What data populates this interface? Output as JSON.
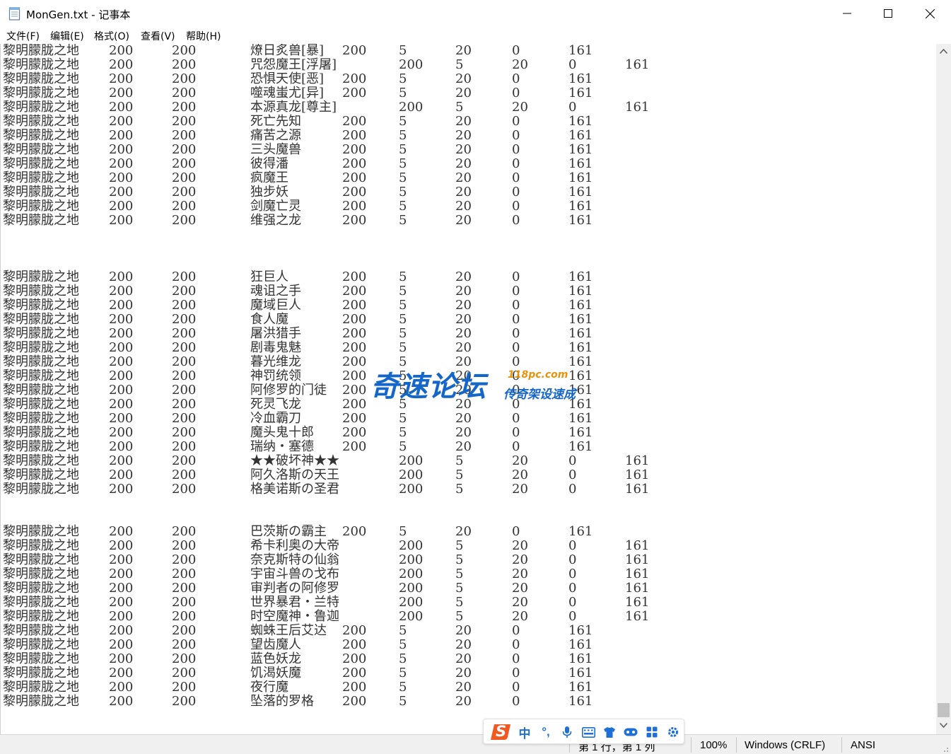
{
  "window": {
    "title": "MonGen.txt - 记事本",
    "icon": "notepad-icon"
  },
  "menu": {
    "items": [
      "文件(F)",
      "编辑(E)",
      "格式(O)",
      "查看(V)",
      "帮助(H)"
    ]
  },
  "editor": {
    "rows": [
      [
        "黎明朦胧之地",
        "200",
        "200",
        "燎日炙兽[暴]",
        "200",
        "5",
        "20",
        "0",
        "161"
      ],
      [
        "黎明朦胧之地",
        "200",
        "200",
        "咒怨魔王[浮屠]",
        "",
        "200",
        "5",
        "20",
        "0",
        "161"
      ],
      [
        "黎明朦胧之地",
        "200",
        "200",
        "恐惧天使[恶]",
        "200",
        "5",
        "20",
        "0",
        "161"
      ],
      [
        "黎明朦胧之地",
        "200",
        "200",
        "噬魂蚩尤[异]",
        "200",
        "5",
        "20",
        "0",
        "161"
      ],
      [
        "黎明朦胧之地",
        "200",
        "200",
        "本源真龙[尊主]",
        "",
        "200",
        "5",
        "20",
        "0",
        "161"
      ],
      [
        "黎明朦胧之地",
        "200",
        "200",
        "死亡先知",
        "200",
        "5",
        "20",
        "0",
        "161"
      ],
      [
        "黎明朦胧之地",
        "200",
        "200",
        "痛苦之源",
        "200",
        "5",
        "20",
        "0",
        "161"
      ],
      [
        "黎明朦胧之地",
        "200",
        "200",
        "三头魔兽",
        "200",
        "5",
        "20",
        "0",
        "161"
      ],
      [
        "黎明朦胧之地",
        "200",
        "200",
        "彼得潘",
        "200",
        "5",
        "20",
        "0",
        "161"
      ],
      [
        "黎明朦胧之地",
        "200",
        "200",
        "疯魔王",
        "200",
        "5",
        "20",
        "0",
        "161"
      ],
      [
        "黎明朦胧之地",
        "200",
        "200",
        "独步妖",
        "200",
        "5",
        "20",
        "0",
        "161"
      ],
      [
        "黎明朦胧之地",
        "200",
        "200",
        "剑魔亡灵",
        "200",
        "5",
        "20",
        "0",
        "161"
      ],
      [
        "黎明朦胧之地",
        "200",
        "200",
        "维强之龙",
        "200",
        "5",
        "20",
        "0",
        "161"
      ],
      [],
      [],
      [],
      [
        "黎明朦胧之地",
        "200",
        "200",
        "狂巨人",
        "200",
        "5",
        "20",
        "0",
        "161"
      ],
      [
        "黎明朦胧之地",
        "200",
        "200",
        "魂诅之手",
        "200",
        "5",
        "20",
        "0",
        "161"
      ],
      [
        "黎明朦胧之地",
        "200",
        "200",
        "魔域巨人",
        "200",
        "5",
        "20",
        "0",
        "161"
      ],
      [
        "黎明朦胧之地",
        "200",
        "200",
        "食人魔",
        "200",
        "5",
        "20",
        "0",
        "161"
      ],
      [
        "黎明朦胧之地",
        "200",
        "200",
        "屠洪猎手",
        "200",
        "5",
        "20",
        "0",
        "161"
      ],
      [
        "黎明朦胧之地",
        "200",
        "200",
        "剧毒鬼魅",
        "200",
        "5",
        "20",
        "0",
        "161"
      ],
      [
        "黎明朦胧之地",
        "200",
        "200",
        "暮光维龙",
        "200",
        "5",
        "20",
        "0",
        "161"
      ],
      [
        "黎明朦胧之地",
        "200",
        "200",
        "神罚统领",
        "200",
        "5",
        "20",
        "0",
        "161"
      ],
      [
        "黎明朦胧之地",
        "200",
        "200",
        "阿修罗的门徒",
        "200",
        "5",
        "20",
        "0",
        "161"
      ],
      [
        "黎明朦胧之地",
        "200",
        "200",
        "死灵飞龙",
        "200",
        "5",
        "20",
        "0",
        "161"
      ],
      [
        "黎明朦胧之地",
        "200",
        "200",
        "冷血霸刀",
        "200",
        "5",
        "20",
        "0",
        "161"
      ],
      [
        "黎明朦胧之地",
        "200",
        "200",
        "魔头鬼十郎",
        "200",
        "5",
        "20",
        "0",
        "161"
      ],
      [
        "黎明朦胧之地",
        "200",
        "200",
        "瑞纳・塞德",
        "200",
        "5",
        "20",
        "0",
        "161"
      ],
      [
        "黎明朦胧之地",
        "200",
        "200",
        "★★破坏神★★",
        "",
        "200",
        "5",
        "20",
        "0",
        "161"
      ],
      [
        "黎明朦胧之地",
        "200",
        "200",
        "阿久洛斯の天王",
        "",
        "200",
        "5",
        "20",
        "0",
        "161"
      ],
      [
        "黎明朦胧之地",
        "200",
        "200",
        "格美诺斯の圣君",
        "",
        "200",
        "5",
        "20",
        "0",
        "161"
      ],
      [],
      [],
      [
        "黎明朦胧之地",
        "200",
        "200",
        "巴茨斯の霸主",
        "200",
        "5",
        "20",
        "0",
        "161"
      ],
      [
        "黎明朦胧之地",
        "200",
        "200",
        "希卡利奥の大帝",
        "",
        "200",
        "5",
        "20",
        "0",
        "161"
      ],
      [
        "黎明朦胧之地",
        "200",
        "200",
        "奈克斯特の仙翁",
        "",
        "200",
        "5",
        "20",
        "0",
        "161"
      ],
      [
        "黎明朦胧之地",
        "200",
        "200",
        "宇宙斗兽の戈布",
        "",
        "200",
        "5",
        "20",
        "0",
        "161"
      ],
      [
        "黎明朦胧之地",
        "200",
        "200",
        "审判者の阿修罗",
        "",
        "200",
        "5",
        "20",
        "0",
        "161"
      ],
      [
        "黎明朦胧之地",
        "200",
        "200",
        "世界暴君・兰特",
        "",
        "200",
        "5",
        "20",
        "0",
        "161"
      ],
      [
        "黎明朦胧之地",
        "200",
        "200",
        "时空魔神・鲁迦",
        "",
        "200",
        "5",
        "20",
        "0",
        "161"
      ],
      [
        "黎明朦胧之地",
        "200",
        "200",
        "蜘蛛王后艾达",
        "200",
        "5",
        "20",
        "0",
        "161"
      ],
      [
        "黎明朦胧之地",
        "200",
        "200",
        "望齿魔人",
        "200",
        "5",
        "20",
        "0",
        "161"
      ],
      [
        "黎明朦胧之地",
        "200",
        "200",
        "蓝色妖龙",
        "200",
        "5",
        "20",
        "0",
        "161"
      ],
      [
        "黎明朦胧之地",
        "200",
        "200",
        "饥渴妖魔",
        "200",
        "5",
        "20",
        "0",
        "161"
      ],
      [
        "黎明朦胧之地",
        "200",
        "200",
        "夜行魔",
        "200",
        "5",
        "20",
        "0",
        "161"
      ],
      [
        "黎明朦胧之地",
        "200",
        "200",
        "坠落的罗格",
        "200",
        "5",
        "20",
        "0",
        "161"
      ]
    ]
  },
  "status": {
    "position": "第 1 行，第 1 列",
    "zoom": "100%",
    "line_ending": "Windows (CRLF)",
    "encoding": "ANSI"
  },
  "ime": {
    "logo": "S",
    "mode": "中",
    "punct": "°,",
    "icons": [
      "microphone-icon",
      "keyboard-icon",
      "skin-icon",
      "game-icon",
      "grid-icon",
      "settings-icon"
    ]
  },
  "watermark": {
    "main": "奇速论坛",
    "url": "118pc.com",
    "sub": "传奇架设速成"
  }
}
